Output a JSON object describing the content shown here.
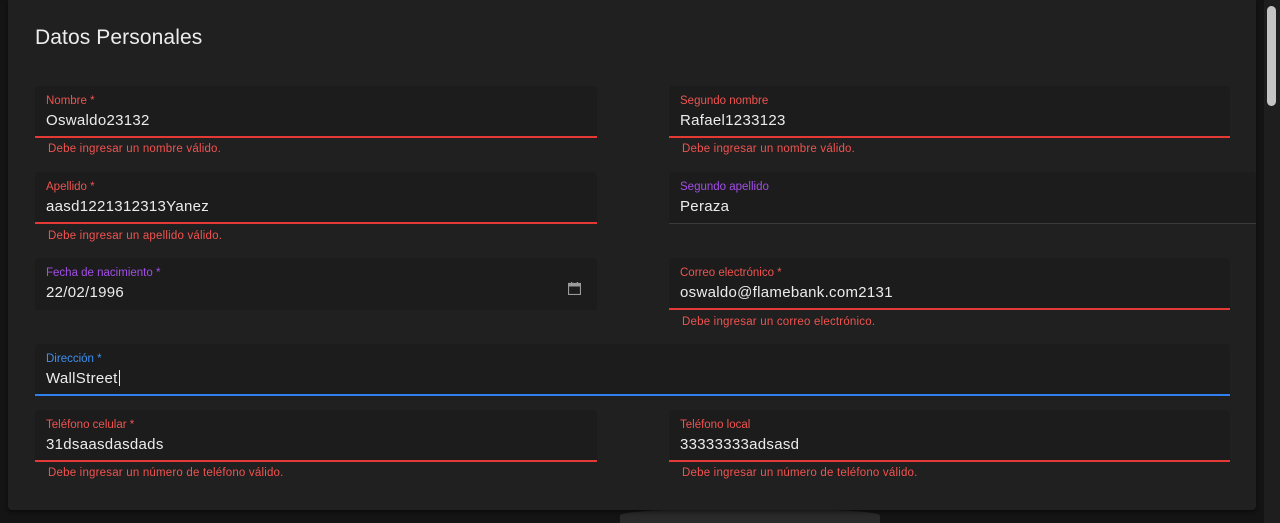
{
  "form": {
    "title": "Datos Personales",
    "fields": {
      "nombre": {
        "label": "Nombre *",
        "value": "Oswaldo23132",
        "error": "Debe ingresar un nombre válido."
      },
      "segundo_nombre": {
        "label": "Segundo nombre",
        "value": "Rafael1233123",
        "error": "Debe ingresar un nombre válido."
      },
      "apellido": {
        "label": "Apellido *",
        "value": "aasd1221312313Yanez",
        "error": "Debe ingresar un apellido válido."
      },
      "segundo_apellido": {
        "label": "Segundo apellido",
        "value": "Peraza"
      },
      "fecha_nacimiento": {
        "label": "Fecha de nacimiento *",
        "value": "22/02/1996",
        "icon": "calendar-icon"
      },
      "correo": {
        "label": "Correo electrónico *",
        "value": "oswaldo@flamebank.com2131",
        "error": "Debe ingresar un correo electrónico."
      },
      "direccion": {
        "label": "Dirección *",
        "value": "WallStreet"
      },
      "telefono_celular": {
        "label": "Teléfono celular *",
        "value": "31dsaasdasdads",
        "error": "Debe ingresar un número de teléfono válido."
      },
      "telefono_local": {
        "label": "Teléfono local",
        "value": "33333333adsasd",
        "error": "Debe ingresar un número de teléfono válido."
      }
    }
  },
  "colors": {
    "error": "#ef5350",
    "focus": "#2f80ed",
    "label_purple": "#a34ee6",
    "card_bg": "#202020",
    "field_bg": "#1c1c1c"
  }
}
